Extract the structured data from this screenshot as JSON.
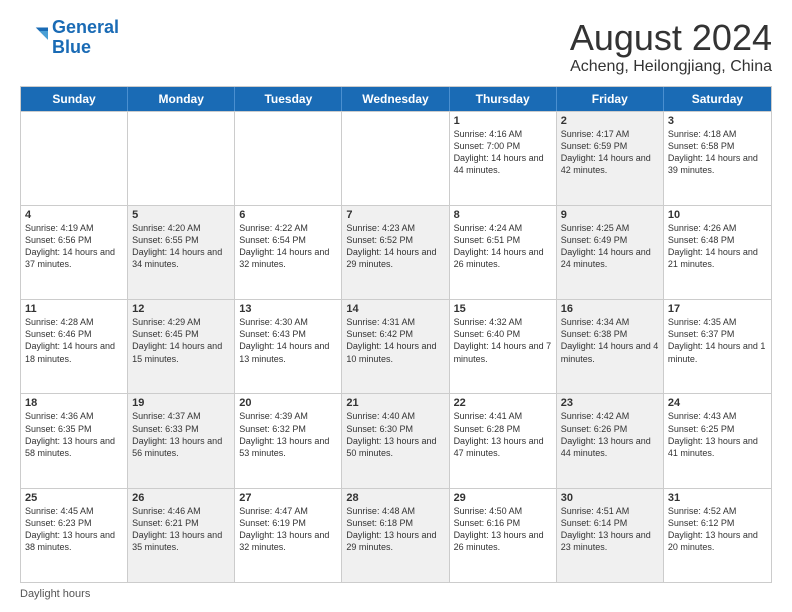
{
  "header": {
    "logo_line1": "General",
    "logo_line2": "Blue",
    "title": "August 2024",
    "subtitle": "Acheng, Heilongjiang, China"
  },
  "days_of_week": [
    "Sunday",
    "Monday",
    "Tuesday",
    "Wednesday",
    "Thursday",
    "Friday",
    "Saturday"
  ],
  "rows": [
    [
      {
        "num": "",
        "sunrise": "",
        "sunset": "",
        "daylight": "",
        "shaded": false,
        "empty": true
      },
      {
        "num": "",
        "sunrise": "",
        "sunset": "",
        "daylight": "",
        "shaded": false,
        "empty": true
      },
      {
        "num": "",
        "sunrise": "",
        "sunset": "",
        "daylight": "",
        "shaded": false,
        "empty": true
      },
      {
        "num": "",
        "sunrise": "",
        "sunset": "",
        "daylight": "",
        "shaded": false,
        "empty": true
      },
      {
        "num": "1",
        "sunrise": "Sunrise: 4:16 AM",
        "sunset": "Sunset: 7:00 PM",
        "daylight": "Daylight: 14 hours and 44 minutes.",
        "shaded": false,
        "empty": false
      },
      {
        "num": "2",
        "sunrise": "Sunrise: 4:17 AM",
        "sunset": "Sunset: 6:59 PM",
        "daylight": "Daylight: 14 hours and 42 minutes.",
        "shaded": true,
        "empty": false
      },
      {
        "num": "3",
        "sunrise": "Sunrise: 4:18 AM",
        "sunset": "Sunset: 6:58 PM",
        "daylight": "Daylight: 14 hours and 39 minutes.",
        "shaded": false,
        "empty": false
      }
    ],
    [
      {
        "num": "4",
        "sunrise": "Sunrise: 4:19 AM",
        "sunset": "Sunset: 6:56 PM",
        "daylight": "Daylight: 14 hours and 37 minutes.",
        "shaded": false,
        "empty": false
      },
      {
        "num": "5",
        "sunrise": "Sunrise: 4:20 AM",
        "sunset": "Sunset: 6:55 PM",
        "daylight": "Daylight: 14 hours and 34 minutes.",
        "shaded": true,
        "empty": false
      },
      {
        "num": "6",
        "sunrise": "Sunrise: 4:22 AM",
        "sunset": "Sunset: 6:54 PM",
        "daylight": "Daylight: 14 hours and 32 minutes.",
        "shaded": false,
        "empty": false
      },
      {
        "num": "7",
        "sunrise": "Sunrise: 4:23 AM",
        "sunset": "Sunset: 6:52 PM",
        "daylight": "Daylight: 14 hours and 29 minutes.",
        "shaded": true,
        "empty": false
      },
      {
        "num": "8",
        "sunrise": "Sunrise: 4:24 AM",
        "sunset": "Sunset: 6:51 PM",
        "daylight": "Daylight: 14 hours and 26 minutes.",
        "shaded": false,
        "empty": false
      },
      {
        "num": "9",
        "sunrise": "Sunrise: 4:25 AM",
        "sunset": "Sunset: 6:49 PM",
        "daylight": "Daylight: 14 hours and 24 minutes.",
        "shaded": true,
        "empty": false
      },
      {
        "num": "10",
        "sunrise": "Sunrise: 4:26 AM",
        "sunset": "Sunset: 6:48 PM",
        "daylight": "Daylight: 14 hours and 21 minutes.",
        "shaded": false,
        "empty": false
      }
    ],
    [
      {
        "num": "11",
        "sunrise": "Sunrise: 4:28 AM",
        "sunset": "Sunset: 6:46 PM",
        "daylight": "Daylight: 14 hours and 18 minutes.",
        "shaded": false,
        "empty": false
      },
      {
        "num": "12",
        "sunrise": "Sunrise: 4:29 AM",
        "sunset": "Sunset: 6:45 PM",
        "daylight": "Daylight: 14 hours and 15 minutes.",
        "shaded": true,
        "empty": false
      },
      {
        "num": "13",
        "sunrise": "Sunrise: 4:30 AM",
        "sunset": "Sunset: 6:43 PM",
        "daylight": "Daylight: 14 hours and 13 minutes.",
        "shaded": false,
        "empty": false
      },
      {
        "num": "14",
        "sunrise": "Sunrise: 4:31 AM",
        "sunset": "Sunset: 6:42 PM",
        "daylight": "Daylight: 14 hours and 10 minutes.",
        "shaded": true,
        "empty": false
      },
      {
        "num": "15",
        "sunrise": "Sunrise: 4:32 AM",
        "sunset": "Sunset: 6:40 PM",
        "daylight": "Daylight: 14 hours and 7 minutes.",
        "shaded": false,
        "empty": false
      },
      {
        "num": "16",
        "sunrise": "Sunrise: 4:34 AM",
        "sunset": "Sunset: 6:38 PM",
        "daylight": "Daylight: 14 hours and 4 minutes.",
        "shaded": true,
        "empty": false
      },
      {
        "num": "17",
        "sunrise": "Sunrise: 4:35 AM",
        "sunset": "Sunset: 6:37 PM",
        "daylight": "Daylight: 14 hours and 1 minute.",
        "shaded": false,
        "empty": false
      }
    ],
    [
      {
        "num": "18",
        "sunrise": "Sunrise: 4:36 AM",
        "sunset": "Sunset: 6:35 PM",
        "daylight": "Daylight: 13 hours and 58 minutes.",
        "shaded": false,
        "empty": false
      },
      {
        "num": "19",
        "sunrise": "Sunrise: 4:37 AM",
        "sunset": "Sunset: 6:33 PM",
        "daylight": "Daylight: 13 hours and 56 minutes.",
        "shaded": true,
        "empty": false
      },
      {
        "num": "20",
        "sunrise": "Sunrise: 4:39 AM",
        "sunset": "Sunset: 6:32 PM",
        "daylight": "Daylight: 13 hours and 53 minutes.",
        "shaded": false,
        "empty": false
      },
      {
        "num": "21",
        "sunrise": "Sunrise: 4:40 AM",
        "sunset": "Sunset: 6:30 PM",
        "daylight": "Daylight: 13 hours and 50 minutes.",
        "shaded": true,
        "empty": false
      },
      {
        "num": "22",
        "sunrise": "Sunrise: 4:41 AM",
        "sunset": "Sunset: 6:28 PM",
        "daylight": "Daylight: 13 hours and 47 minutes.",
        "shaded": false,
        "empty": false
      },
      {
        "num": "23",
        "sunrise": "Sunrise: 4:42 AM",
        "sunset": "Sunset: 6:26 PM",
        "daylight": "Daylight: 13 hours and 44 minutes.",
        "shaded": true,
        "empty": false
      },
      {
        "num": "24",
        "sunrise": "Sunrise: 4:43 AM",
        "sunset": "Sunset: 6:25 PM",
        "daylight": "Daylight: 13 hours and 41 minutes.",
        "shaded": false,
        "empty": false
      }
    ],
    [
      {
        "num": "25",
        "sunrise": "Sunrise: 4:45 AM",
        "sunset": "Sunset: 6:23 PM",
        "daylight": "Daylight: 13 hours and 38 minutes.",
        "shaded": false,
        "empty": false
      },
      {
        "num": "26",
        "sunrise": "Sunrise: 4:46 AM",
        "sunset": "Sunset: 6:21 PM",
        "daylight": "Daylight: 13 hours and 35 minutes.",
        "shaded": true,
        "empty": false
      },
      {
        "num": "27",
        "sunrise": "Sunrise: 4:47 AM",
        "sunset": "Sunset: 6:19 PM",
        "daylight": "Daylight: 13 hours and 32 minutes.",
        "shaded": false,
        "empty": false
      },
      {
        "num": "28",
        "sunrise": "Sunrise: 4:48 AM",
        "sunset": "Sunset: 6:18 PM",
        "daylight": "Daylight: 13 hours and 29 minutes.",
        "shaded": true,
        "empty": false
      },
      {
        "num": "29",
        "sunrise": "Sunrise: 4:50 AM",
        "sunset": "Sunset: 6:16 PM",
        "daylight": "Daylight: 13 hours and 26 minutes.",
        "shaded": false,
        "empty": false
      },
      {
        "num": "30",
        "sunrise": "Sunrise: 4:51 AM",
        "sunset": "Sunset: 6:14 PM",
        "daylight": "Daylight: 13 hours and 23 minutes.",
        "shaded": true,
        "empty": false
      },
      {
        "num": "31",
        "sunrise": "Sunrise: 4:52 AM",
        "sunset": "Sunset: 6:12 PM",
        "daylight": "Daylight: 13 hours and 20 minutes.",
        "shaded": false,
        "empty": false
      }
    ]
  ],
  "footer": {
    "text": "Daylight hours"
  }
}
